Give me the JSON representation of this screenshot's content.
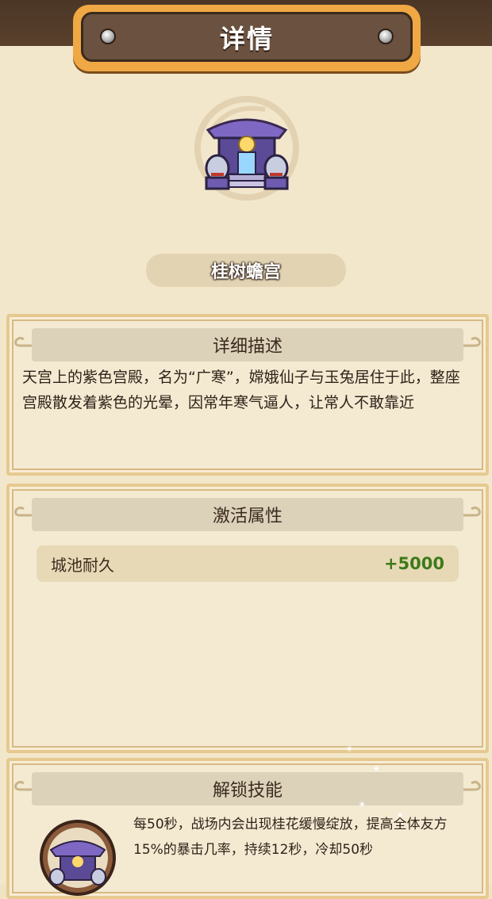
{
  "header": {
    "title": "详情"
  },
  "building": {
    "name": "桂树蟾宫",
    "icon": "purple-palace-icon"
  },
  "description_panel": {
    "heading": "详细描述",
    "text": "天宫上的紫色宫殿，名为“广寒”，嫦娥仙子与玉兔居住于此，整座宫殿散发着紫色的光晕，因常年寒气逼人，让常人不敢靠近"
  },
  "attributes_panel": {
    "heading": "激活属性",
    "rows": [
      {
        "label": "城池耐久",
        "value": "+5000"
      }
    ]
  },
  "skill_panel": {
    "heading": "解锁技能",
    "text": "每50秒，战场内会出现桂花缓慢绽放，提高全体友方15%的暴击几率，持续12秒，冷却50秒"
  },
  "colors": {
    "accent": "#f0a844",
    "title_plate": "#6b513f",
    "positive_value": "#3d7a1b",
    "panel_border": "#e6c98f"
  }
}
